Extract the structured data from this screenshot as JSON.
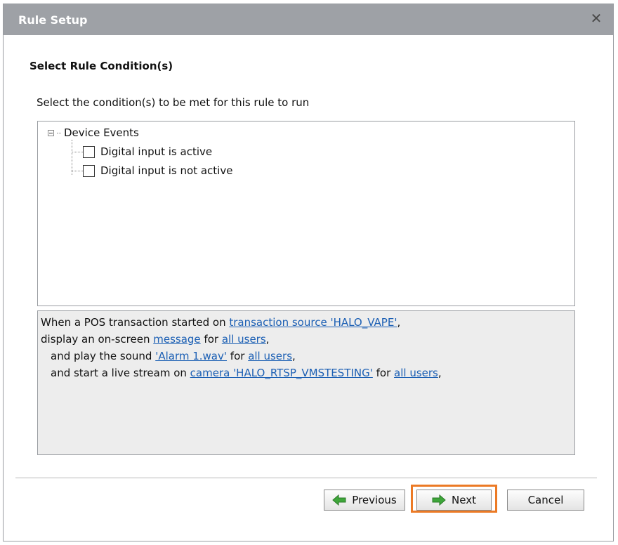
{
  "window": {
    "title": "Rule Setup"
  },
  "heading": "Select Rule Condition(s)",
  "instruction": "Select the condition(s) to be met for this rule to run",
  "tree": {
    "root": "Device Events",
    "items": [
      {
        "label": "Digital input is active",
        "checked": false
      },
      {
        "label": "Digital input is not active",
        "checked": false
      }
    ]
  },
  "summary": {
    "line1": {
      "t1": "When a POS transaction started on ",
      "link1": "transaction source 'HALO_VAPE'",
      "t2": ","
    },
    "line2": {
      "t1": "display an on-screen ",
      "link1": "message",
      "t2": " for ",
      "link2": "all users",
      "t3": ","
    },
    "line3": {
      "t1": "and play the sound ",
      "link1": "'Alarm 1.wav'",
      "t2": " for ",
      "link2": "all users",
      "t3": ","
    },
    "line4": {
      "t1": "and start a live stream on ",
      "link1": "camera 'HALO_RTSP_VMSTESTING'",
      "t2": " for ",
      "link2": "all users",
      "t3": ","
    }
  },
  "buttons": {
    "previous": "Previous",
    "next": "Next",
    "cancel": "Cancel"
  },
  "colors": {
    "titlebar": "#9ea1a6",
    "link": "#1b5fb4",
    "highlight": "#ec7a25",
    "arrow": "#3ea63a"
  }
}
